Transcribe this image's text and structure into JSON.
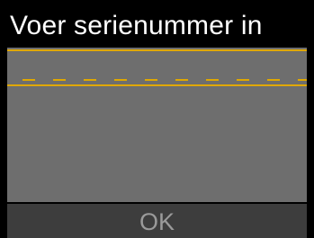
{
  "screen": {
    "title": "Voer serienummer in"
  },
  "serial_input": {
    "value": "",
    "slot_count": 10,
    "accent_color": "#e0a800"
  },
  "softkey": {
    "ok_label": "OK",
    "state": "disabled"
  },
  "colors": {
    "background": "#000000",
    "content": "#6e6e6e",
    "softkey_bar": "#3d3d3d",
    "softkey_text": "#9a9a9a",
    "title_text": "#ffffff"
  }
}
